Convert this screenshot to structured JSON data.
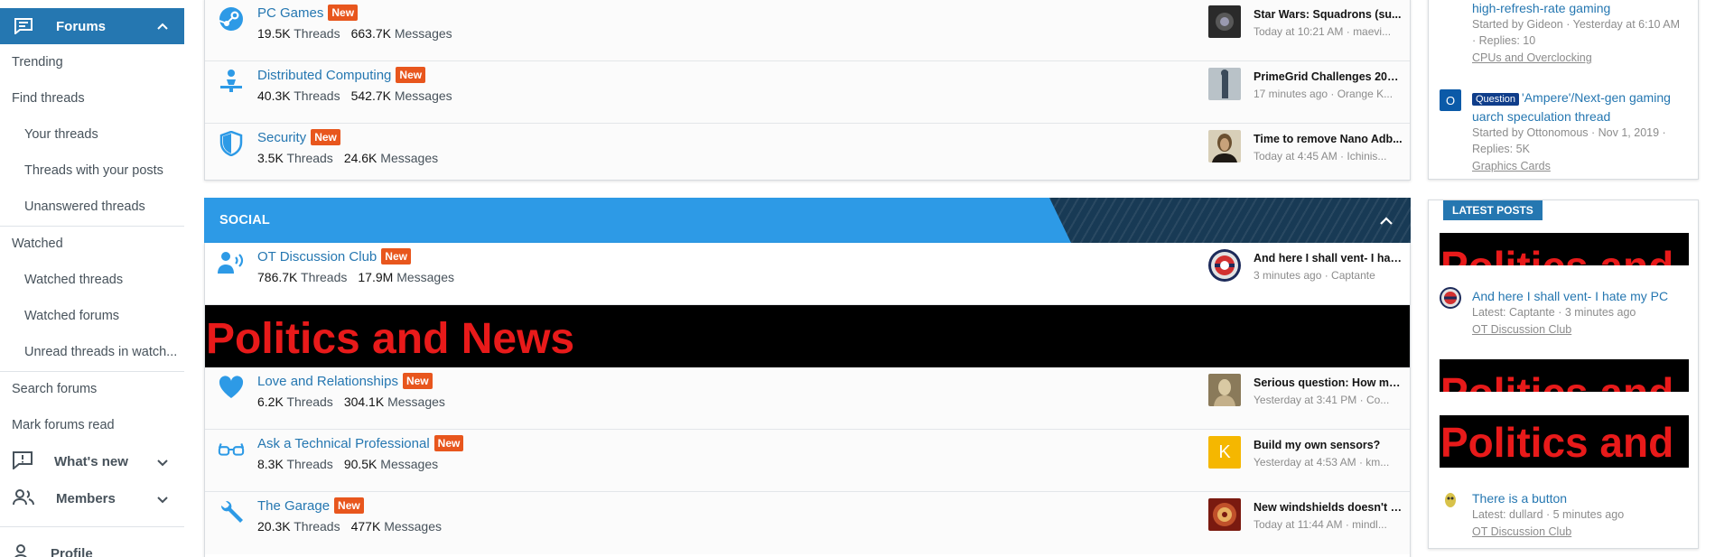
{
  "sidebar": {
    "forums_label": "Forums",
    "items": [
      {
        "label": "Trending"
      },
      {
        "label": "Find threads"
      },
      {
        "label": "Your threads"
      },
      {
        "label": "Threads with your posts"
      },
      {
        "label": "Unanswered threads"
      },
      {
        "label": "Watched"
      },
      {
        "label": "Watched threads"
      },
      {
        "label": "Watched forums"
      },
      {
        "label": "Unread threads in watch..."
      },
      {
        "label": "Search forums"
      },
      {
        "label": "Mark forums read"
      }
    ],
    "whats_new_label": "What's new",
    "members_label": "Members",
    "profile_label": "Profile"
  },
  "nodes_top": [
    {
      "title": "PC Games",
      "new": "New",
      "threads_count": "19.5K",
      "threads_label": "Threads",
      "messages_count": "663.7K",
      "messages_label": "Messages",
      "last_title": "Star Wars: Squadrons (su...",
      "last_meta": "Today at 10:21 AM · maevi...",
      "icon": "steam-icon"
    },
    {
      "title": "Distributed Computing",
      "new": "New",
      "threads_count": "40.3K",
      "threads_label": "Threads",
      "messages_count": "542.7K",
      "messages_label": "Messages",
      "last_title": "PrimeGrid Challenges 202...",
      "last_meta": "17 minutes ago · Orange K...",
      "icon": "distributed-icon"
    },
    {
      "title": "Security",
      "new": "New",
      "threads_count": "3.5K",
      "threads_label": "Threads",
      "messages_count": "24.6K",
      "messages_label": "Messages",
      "last_title": "Time to remove Nano Adb...",
      "last_meta": "Today at 4:45 AM · Ichinis...",
      "icon": "shield-icon"
    }
  ],
  "social": {
    "header": "SOCIAL",
    "nodes": [
      {
        "title": "OT Discussion Club",
        "new": "New",
        "threads_count": "786.7K",
        "threads_label": "Threads",
        "messages_count": "17.9M",
        "messages_label": "Messages",
        "last_title": "And here I shall vent- I hat...",
        "last_meta": "3 minutes ago · Captante",
        "icon": "speaker-icon"
      },
      {
        "title": "Love and Relationships",
        "new": "New",
        "threads_count": "6.2K",
        "threads_label": "Threads",
        "messages_count": "304.1K",
        "messages_label": "Messages",
        "last_title": "Serious question: How ma...",
        "last_meta": "Yesterday at 3:41 PM · Co...",
        "icon": "heart-icon"
      },
      {
        "title": "Ask a Technical Professional",
        "new": "New",
        "threads_count": "8.3K",
        "threads_label": "Threads",
        "messages_count": "90.5K",
        "messages_label": "Messages",
        "last_title": "Build my own sensors?",
        "last_meta": "Yesterday at 4:53 AM · km...",
        "icon": "glasses-icon",
        "avatar_letter": "K"
      },
      {
        "title": "The Garage",
        "new": "New",
        "threads_count": "20.3K",
        "threads_label": "Threads",
        "messages_count": "477K",
        "messages_label": "Messages",
        "last_title": "New windshields doesn't c...",
        "last_meta": "Today at 11:44 AM · mindl...",
        "icon": "wrench-icon"
      }
    ],
    "banner_text": "Politics and News"
  },
  "right": {
    "thread1": {
      "title": "high-refresh-rate gaming",
      "meta": "Started by Gideon · Yesterday at 6:10 AM",
      "replies": "· Replies: 10",
      "forum": "CPUs and Overclocking"
    },
    "thread2": {
      "avatar_letter": "O",
      "badge": "Question",
      "title": "'Ampere'/Next-gen gaming uarch speculation thread",
      "meta": "Started by Ottonomous · Nov 1, 2019 ·",
      "replies": "Replies: 5K",
      "forum": "Graphics Cards"
    },
    "latest_header": "LATEST POSTS",
    "banner_text": "Politics and",
    "post1": {
      "title": "And here I shall vent- I hate my PC",
      "meta": "Latest: Captante · 3 minutes ago",
      "forum": "OT Discussion Club"
    },
    "post2": {
      "title": "There is a button",
      "meta": "Latest: dullard · 5 minutes ago",
      "forum": "OT Discussion Club"
    }
  },
  "colors": {
    "accent": "#2577b1",
    "category": "#2d9ae6",
    "new_badge": "#e8561d",
    "banner_text": "#e81a1a"
  }
}
